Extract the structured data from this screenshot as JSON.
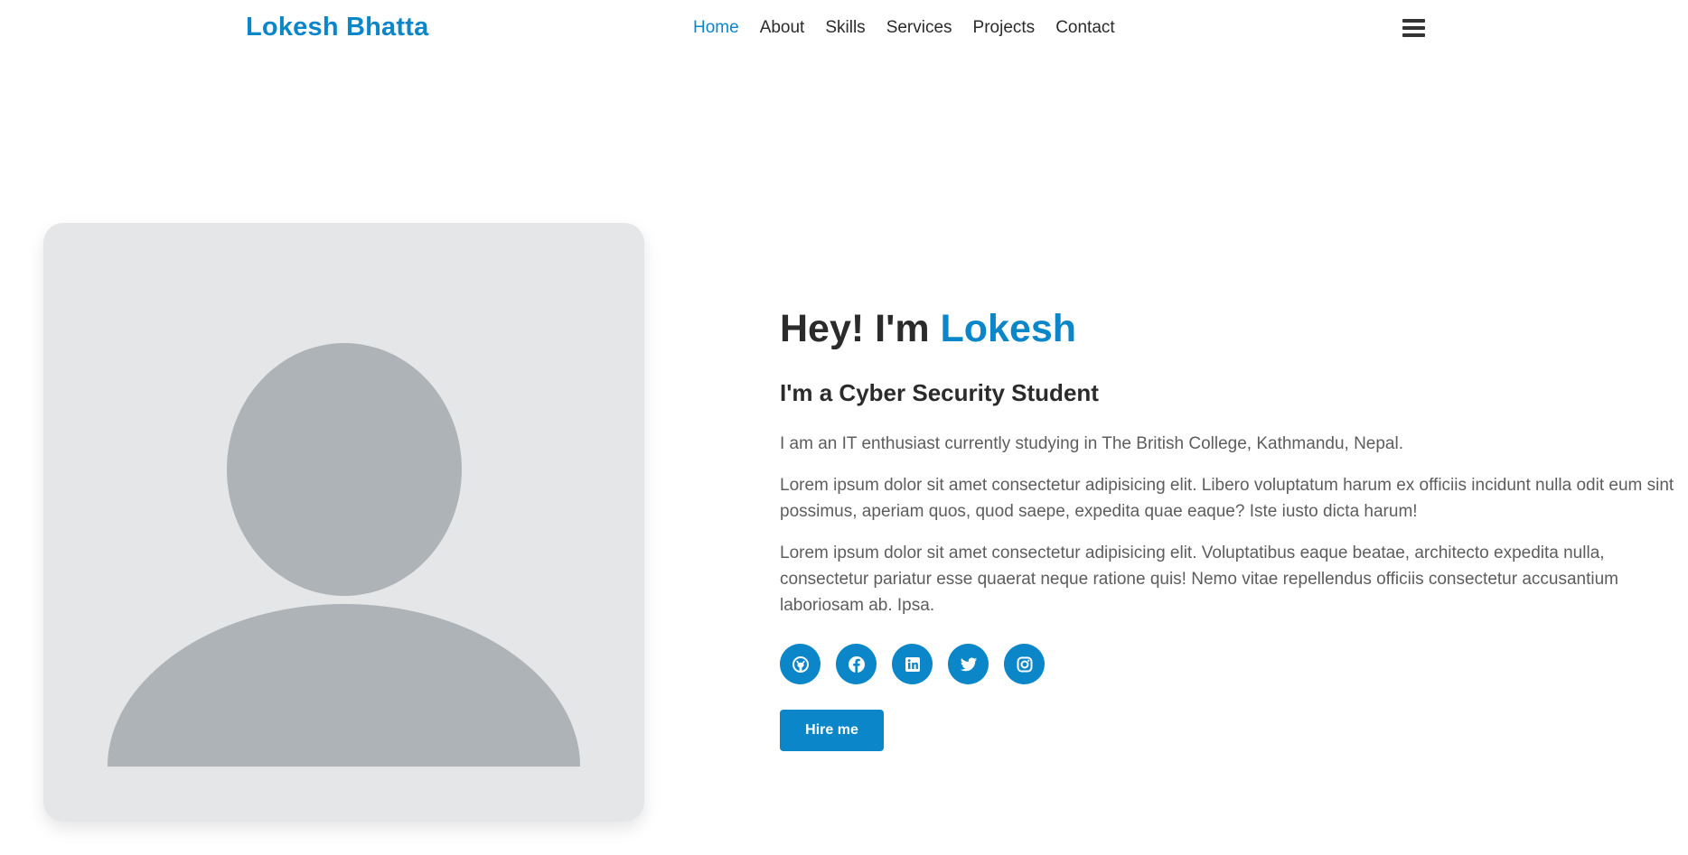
{
  "header": {
    "brand": "Lokesh Bhatta",
    "nav": [
      {
        "label": "Home",
        "active": true
      },
      {
        "label": "About",
        "active": false
      },
      {
        "label": "Skills",
        "active": false
      },
      {
        "label": "Services",
        "active": false
      },
      {
        "label": "Projects",
        "active": false
      },
      {
        "label": "Contact",
        "active": false
      }
    ],
    "menu_icon": "hamburger-menu-icon"
  },
  "hero": {
    "image_icon": "user-placeholder-icon",
    "title_prefix": "Hey! I'm",
    "title_name": "Lokesh",
    "subtitle": "I'm a Cyber Security Student",
    "paragraphs": [
      "I am an IT enthusiast currently studying in The British College, Kathmandu, Nepal.",
      "Lorem ipsum dolor sit amet consectetur adipisicing elit. Libero voluptatum harum ex officiis incidunt nulla odit eum sint possimus, aperiam quos, quod saepe, expedita quae eaque? Iste iusto dicta harum!",
      "Lorem ipsum dolor sit amet consectetur adipisicing elit. Voluptatibus eaque beatae, architecto expedita nulla, consectetur pariatur esse quaerat neque ratione quis! Nemo vitae repellendus officiis consectetur accusantium laboriosam ab. Ipsa."
    ],
    "socials": [
      {
        "icon": "github-icon"
      },
      {
        "icon": "facebook-icon"
      },
      {
        "icon": "linkedin-icon"
      },
      {
        "icon": "twitter-icon"
      },
      {
        "icon": "instagram-icon"
      }
    ],
    "cta_label": "Hire me"
  },
  "colors": {
    "accent": "#0a86c9",
    "text_dark": "#2b2b2b",
    "text_muted": "#5d5d5d",
    "card_bg": "#e4e6e8",
    "silhouette": "#aeb3b7"
  }
}
